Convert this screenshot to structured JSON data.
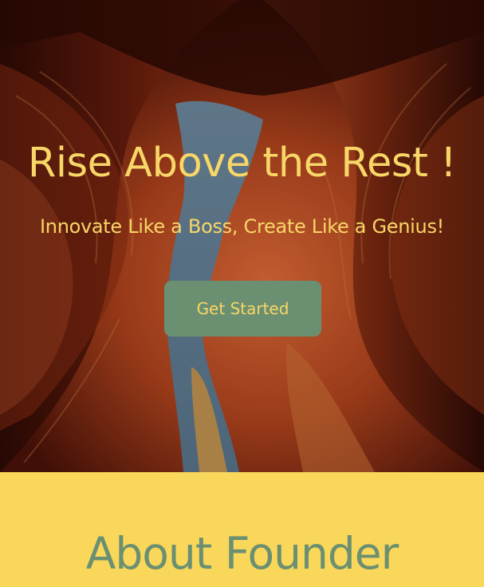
{
  "hero": {
    "title": "Rise Above the Rest !",
    "subtitle": "Innovate Like a Boss, Create Like a Genius!",
    "button_label": "Get Started",
    "background_image": "slot-canyon-rock-photo"
  },
  "about": {
    "title": "About Founder"
  },
  "colors": {
    "hero_text": "#f8d667",
    "button_bg": "#6b8f71",
    "button_text": "#f8d667",
    "about_bg": "#f9d75a",
    "about_title": "#6b8f71"
  }
}
